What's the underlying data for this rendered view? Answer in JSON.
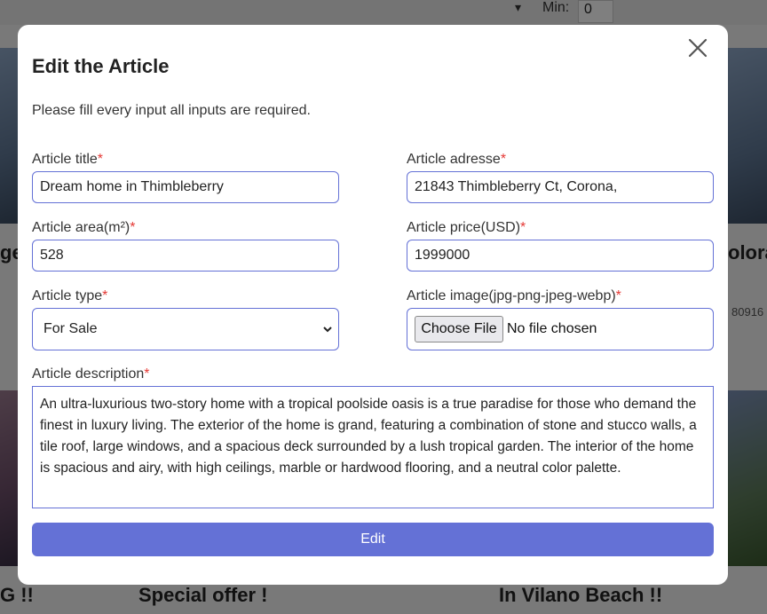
{
  "background": {
    "filter_min_label": "Min:",
    "filter_min_value": "0",
    "card_text_left_mid": "ge",
    "card_text_right_mid": "olora",
    "card_text_right_num": "80916",
    "card_bottom_left": "G !!",
    "card_bottom_mid": "Special offer !",
    "card_bottom_right": "In Vilano Beach !!"
  },
  "modal": {
    "title": "Edit the Article",
    "subtitle": "Please fill every input all inputs are required.",
    "required_mark": "*",
    "fields": {
      "title": {
        "label": "Article title",
        "value": "Dream home in Thimbleberry"
      },
      "address": {
        "label": "Article adresse",
        "value": "21843 Thimbleberry Ct, Corona,"
      },
      "area": {
        "label": "Article area(m²)",
        "value": "528"
      },
      "price": {
        "label": "Article price(USD)",
        "value": "1999000"
      },
      "type": {
        "label": "Article type",
        "value": "For Sale"
      },
      "image": {
        "label": "Article image(jpg-png-jpeg-webp)",
        "button": "Choose File",
        "status": "No file chosen"
      },
      "description": {
        "label": "Article description",
        "value": "An ultra-luxurious two-story home with a tropical poolside oasis is a true paradise for those who demand the finest in luxury living. The exterior of the home is grand, featuring a combination of stone and stucco walls, a tile roof, large windows, and a spacious deck surrounded by a lush tropical garden. The interior of the home is spacious and airy, with high ceilings, marble or hardwood flooring, and a neutral color palette."
      }
    },
    "submit_label": "Edit"
  },
  "colors": {
    "accent": "#6471d6",
    "required": "#e53935"
  }
}
